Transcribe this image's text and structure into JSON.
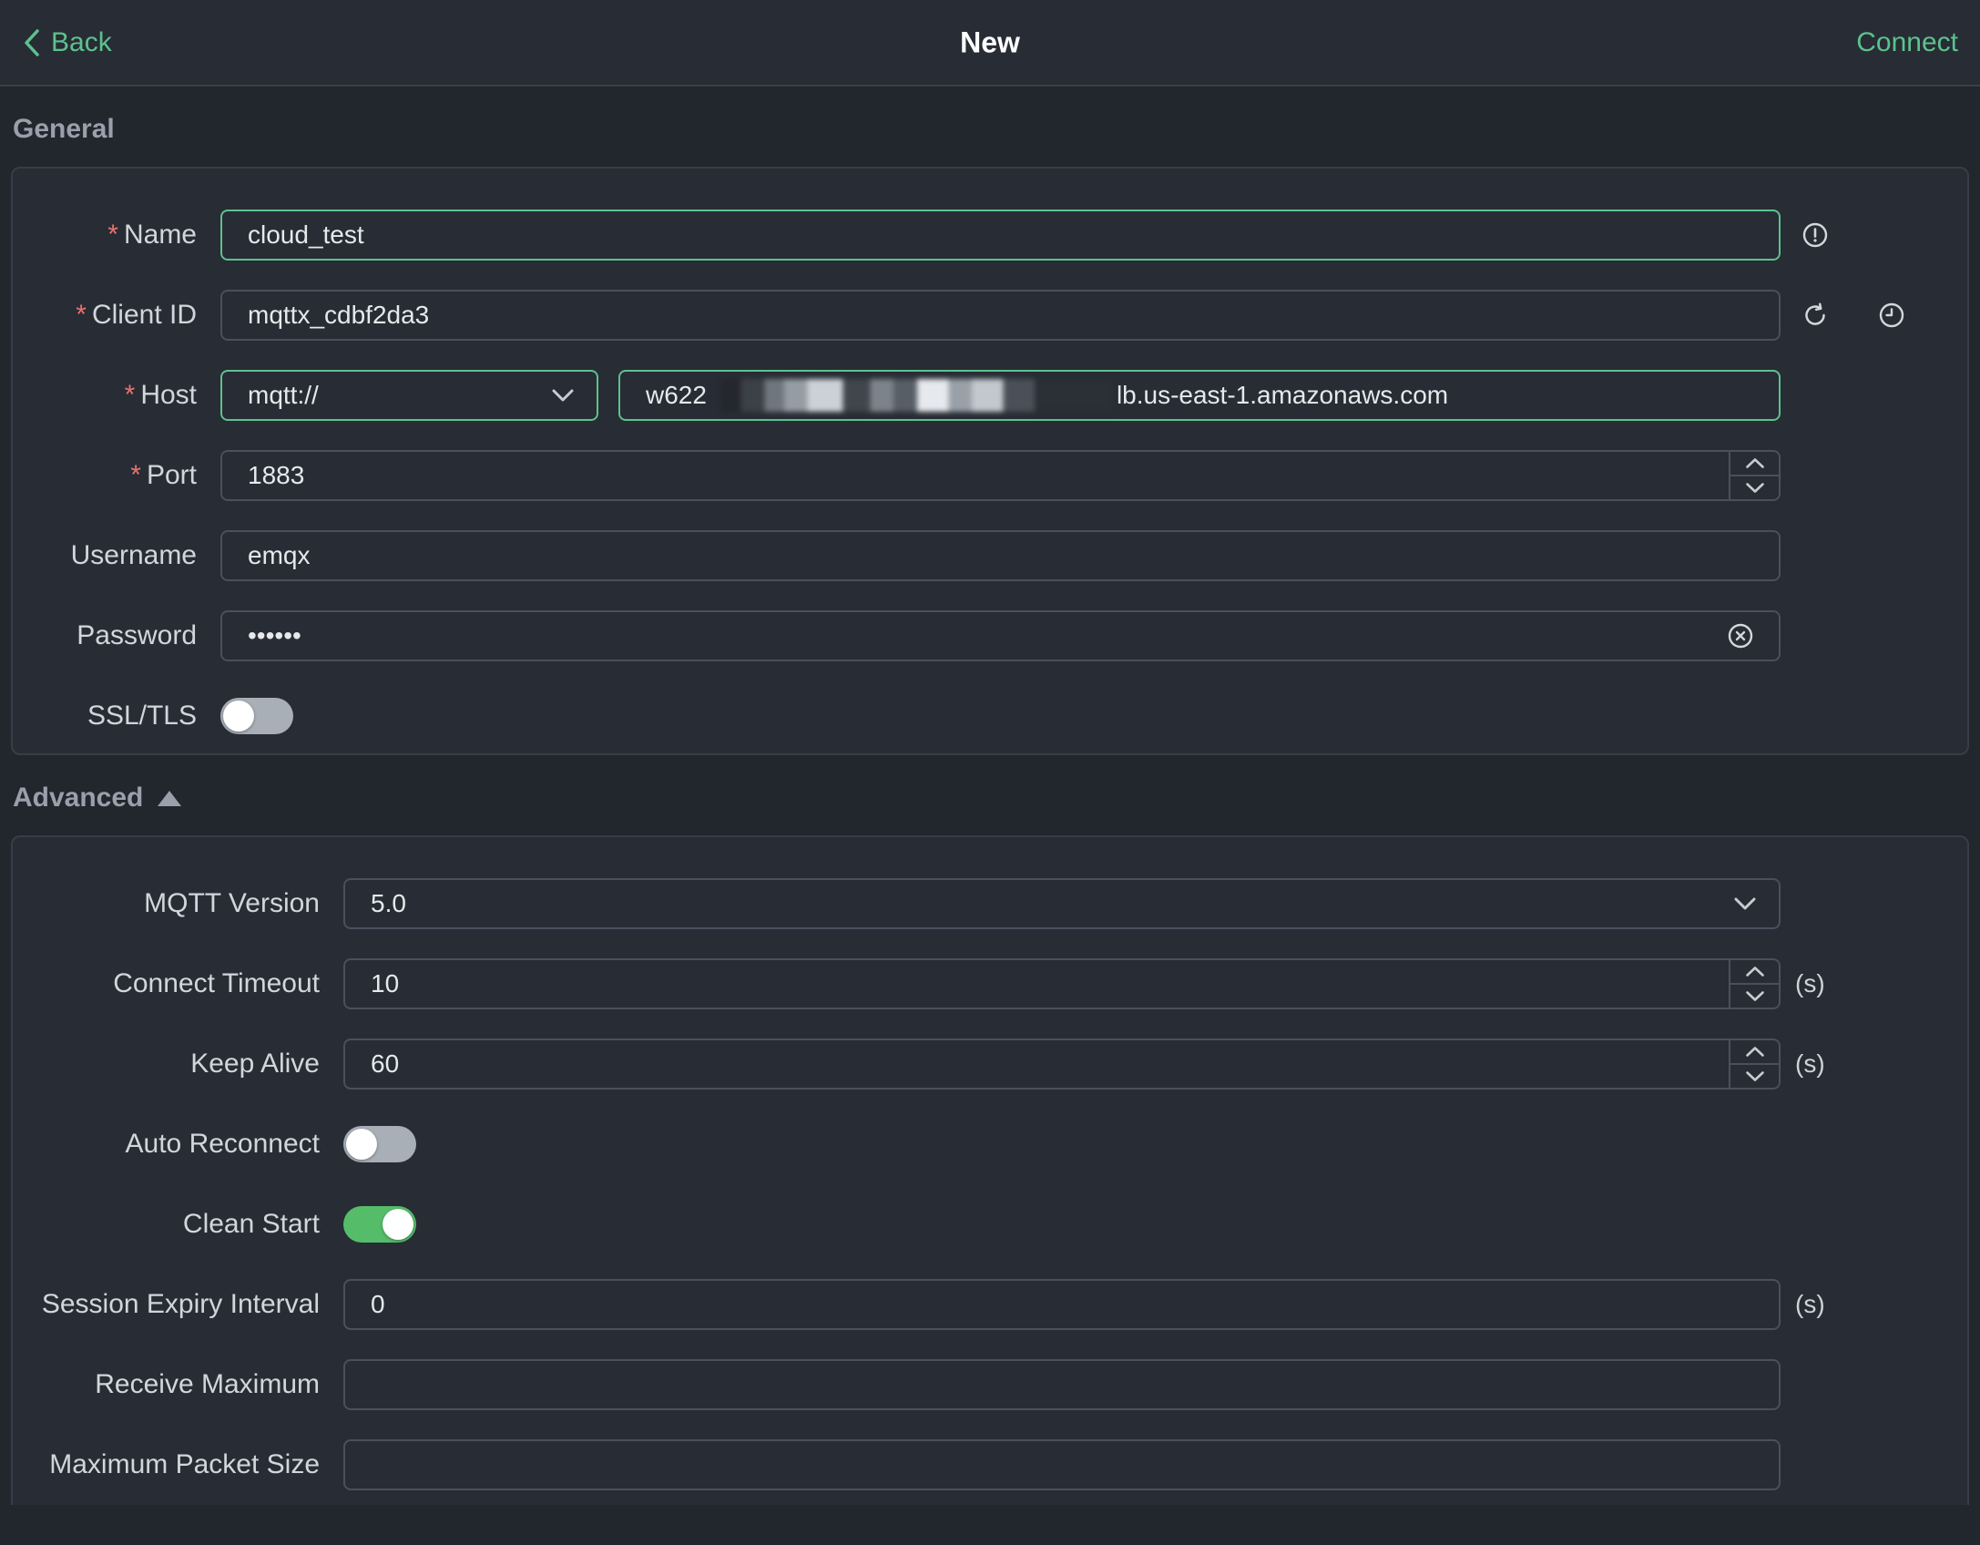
{
  "header": {
    "back_label": "Back",
    "title": "New",
    "connect_label": "Connect"
  },
  "misc": {
    "required_marker": "*"
  },
  "colors": {
    "accent_green": "#5cc28e",
    "toggle_on_green": "#55bd6a",
    "danger_red": "#e9716c",
    "page_bg": "#22262d",
    "card_bg": "#282c34"
  },
  "general": {
    "heading": "General",
    "name": {
      "label": "Name",
      "required": true,
      "value": "cloud_test"
    },
    "client_id": {
      "label": "Client ID",
      "required": true,
      "value": "mqttx_cdbf2da3"
    },
    "host": {
      "label": "Host",
      "required": true,
      "protocol": "mqtt://",
      "value_prefix": "w622",
      "value_redacted": true,
      "value_suffix": "lb.us-east-1.amazonaws.com"
    },
    "port": {
      "label": "Port",
      "required": true,
      "value": "1883"
    },
    "username": {
      "label": "Username",
      "value": "emqx"
    },
    "password": {
      "label": "Password",
      "value": "••••••"
    },
    "ssl": {
      "label": "SSL/TLS",
      "enabled": false
    }
  },
  "advanced": {
    "heading": "Advanced",
    "mqtt_version": {
      "label": "MQTT Version",
      "value": "5.0"
    },
    "connect_timeout": {
      "label": "Connect Timeout",
      "value": "10",
      "unit": "(s)"
    },
    "keep_alive": {
      "label": "Keep Alive",
      "value": "60",
      "unit": "(s)"
    },
    "auto_reconnect": {
      "label": "Auto Reconnect",
      "enabled": false
    },
    "clean_start": {
      "label": "Clean Start",
      "enabled": true
    },
    "session_expiry_interval": {
      "label": "Session Expiry Interval",
      "value": "0",
      "unit": "(s)"
    },
    "receive_maximum": {
      "label": "Receive Maximum",
      "value": ""
    },
    "maximum_packet_size": {
      "label": "Maximum Packet Size",
      "value": ""
    }
  }
}
